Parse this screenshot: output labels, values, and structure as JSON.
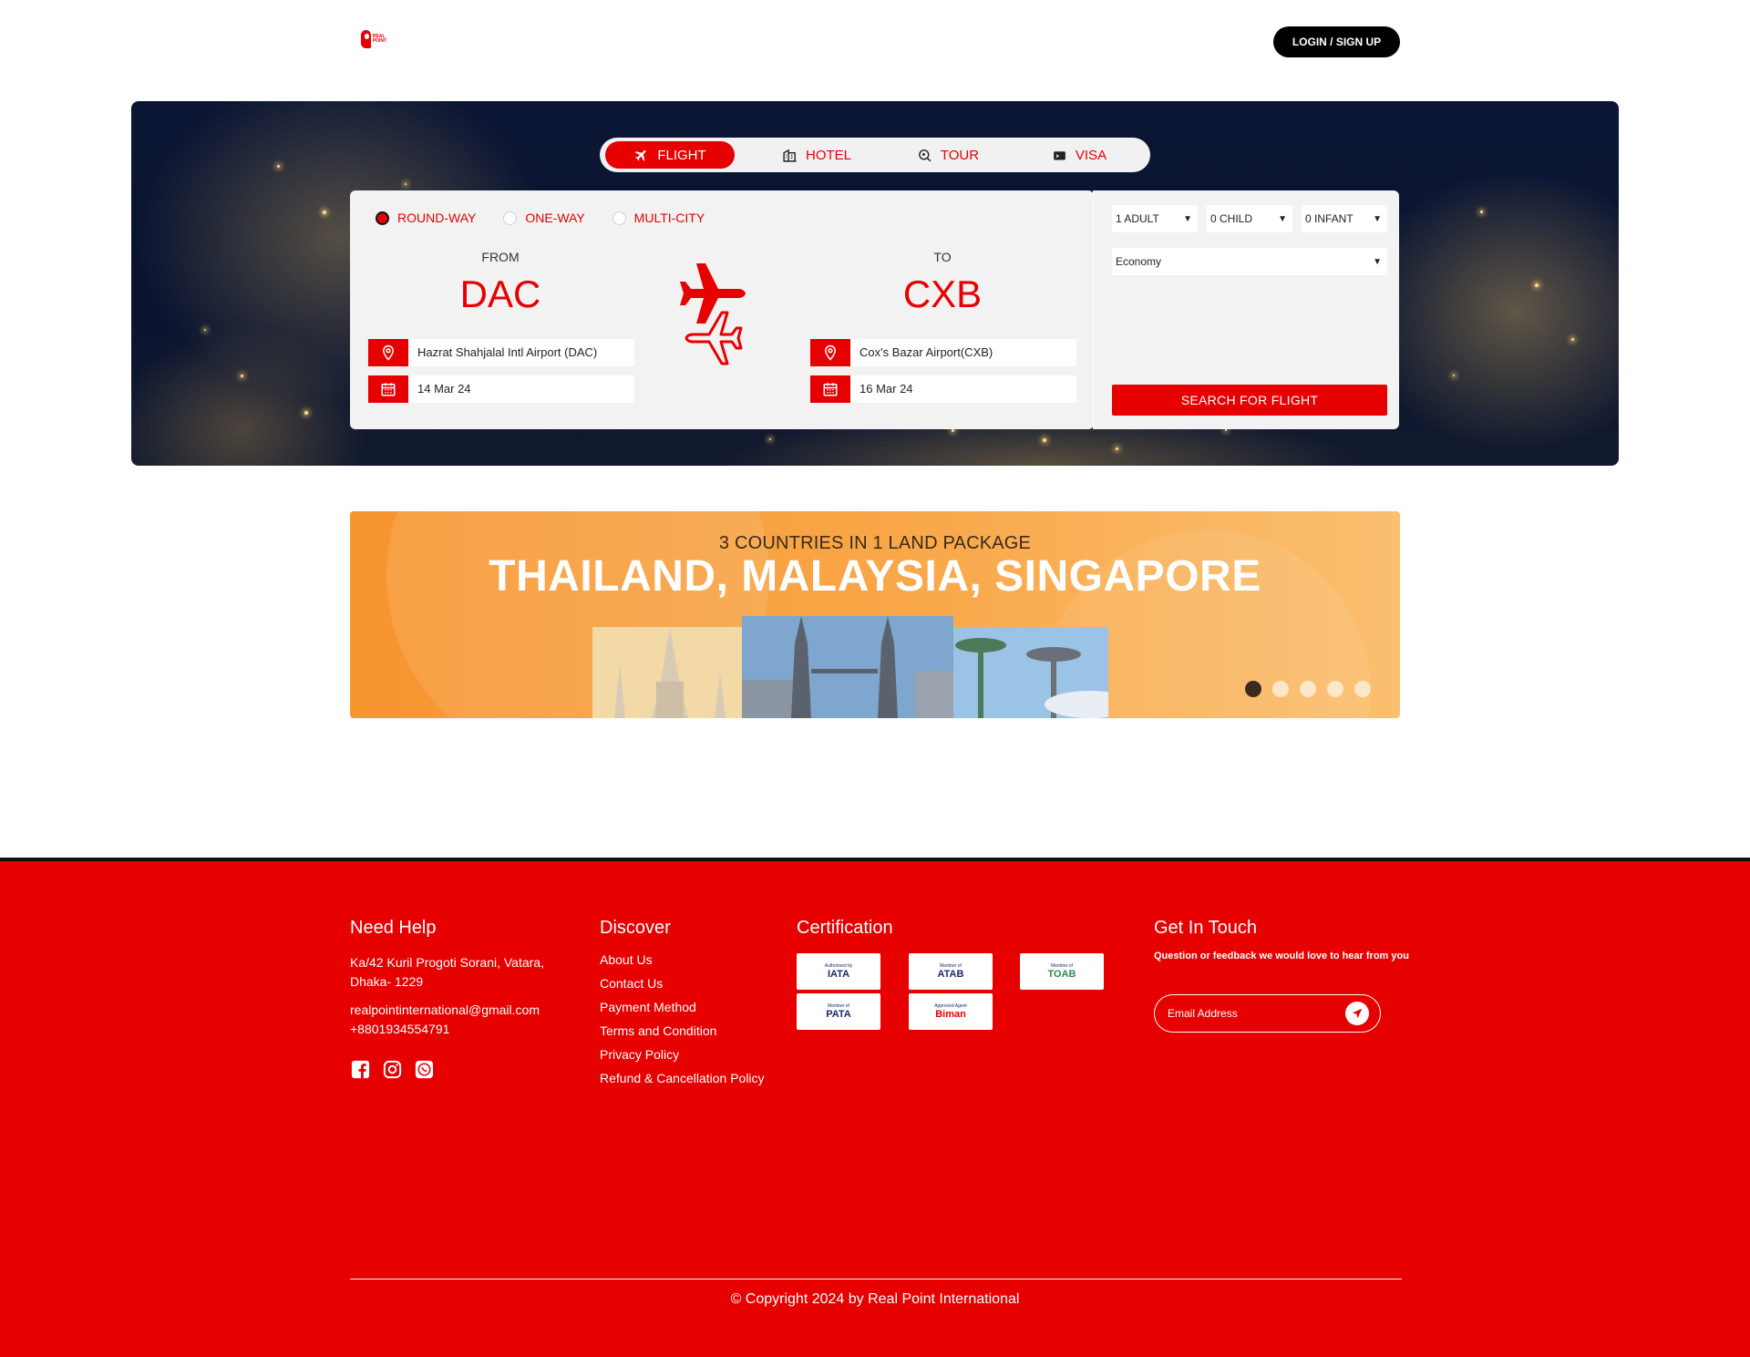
{
  "header": {
    "logo_text": "REAL POINT",
    "login_label": "LOGIN / SIGN UP"
  },
  "tabs": [
    {
      "label": "FLIGHT",
      "icon": "plane-icon",
      "active": true
    },
    {
      "label": "HOTEL",
      "icon": "hotel-icon",
      "active": false
    },
    {
      "label": "TOUR",
      "icon": "tour-icon",
      "active": false
    },
    {
      "label": "VISA",
      "icon": "visa-icon",
      "active": false
    }
  ],
  "trip_types": [
    {
      "label": "ROUND-WAY",
      "checked": true
    },
    {
      "label": "ONE-WAY",
      "checked": false
    },
    {
      "label": "MULTI-CITY",
      "checked": false
    }
  ],
  "from": {
    "label": "FROM",
    "code": "DAC",
    "airport": "Hazrat Shahjalal Intl Airport (DAC)",
    "date": "14 Mar 24"
  },
  "to": {
    "label": "TO",
    "code": "CXB",
    "airport": "Cox's Bazar Airport(CXB)",
    "date": "16 Mar 24"
  },
  "passengers": {
    "adult": "1 ADULT",
    "child": "0 CHILD",
    "infant": "0 INFANT",
    "class": "Economy"
  },
  "search_button": "SEARCH FOR FLIGHT",
  "banner": {
    "subtitle": "3 COUNTRIES IN 1 LAND PACKAGE",
    "title": "THAILAND, MALAYSIA, SINGAPORE",
    "slide_count": 5,
    "active_slide": 1
  },
  "footer": {
    "help": {
      "heading": "Need Help",
      "address": "Ka/42 Kuril Progoti Sorani, Vatara, Dhaka- 1229",
      "email": "realpointinternational@gmail.com",
      "phone": "+8801934554791"
    },
    "discover": {
      "heading": "Discover",
      "links": [
        "About Us",
        "Contact Us",
        "Payment Method",
        "Terms and Condition",
        "Privacy Policy",
        "Refund & Cancellation Policy"
      ]
    },
    "certification": {
      "heading": "Certification",
      "badges": [
        {
          "small": "Authorised by",
          "big": "IATA"
        },
        {
          "small": "Member of",
          "big": "ATAB"
        },
        {
          "small": "Member of",
          "big": "TOAB"
        },
        {
          "small": "Member of",
          "big": "PATA"
        },
        {
          "small": "Approved Agent",
          "big": "Biman"
        }
      ]
    },
    "contact": {
      "heading": "Get In Touch",
      "text": "Question or feedback we would love to hear from you",
      "email_placeholder": "Email Address"
    },
    "copyright": "© Copyright 2024 by Real Point International"
  },
  "colors": {
    "brand_red": "#e60000",
    "black": "#000000"
  }
}
